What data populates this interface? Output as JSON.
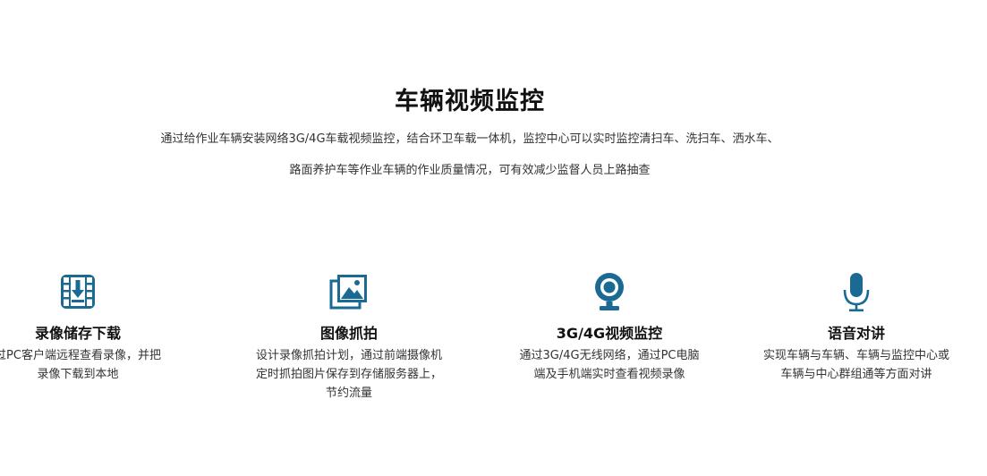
{
  "section": {
    "title": "车辆视频监控",
    "description_line1": "通过给作业车辆安装网络3G/4G车载视频监控，结合环卫车载一体机，监控中心可以实时监控清扫车、洗扫车、洒水车、",
    "description_line2": "路面养护车等作业车辆的作业质量情况，可有效减少监督人员上路抽查"
  },
  "features": [
    {
      "icon": "video-download-icon",
      "title": "录像储存下载",
      "lines": [
        "过PC客户端远程查看录像，并把",
        "录像下载到本地"
      ]
    },
    {
      "icon": "image-capture-icon",
      "title": "图像抓拍",
      "lines": [
        "设计录像抓拍计划，通过前端摄像机",
        "定时抓拍图片保存到存储服务器上，",
        "节约流量"
      ]
    },
    {
      "icon": "webcam-icon",
      "title": "3G/4G视频监控",
      "lines": [
        "通过3G/4G无线网络，通过PC电脑",
        "端及手机端实时查看视频录像"
      ]
    },
    {
      "icon": "microphone-icon",
      "title": "语音对讲",
      "lines": [
        "实现车辆与车辆、车辆与监控中心或",
        "车辆与中心群组通等方面对讲"
      ]
    }
  ],
  "colors": {
    "icon": "#1a6a93",
    "title": "#111111",
    "text": "#333333"
  }
}
